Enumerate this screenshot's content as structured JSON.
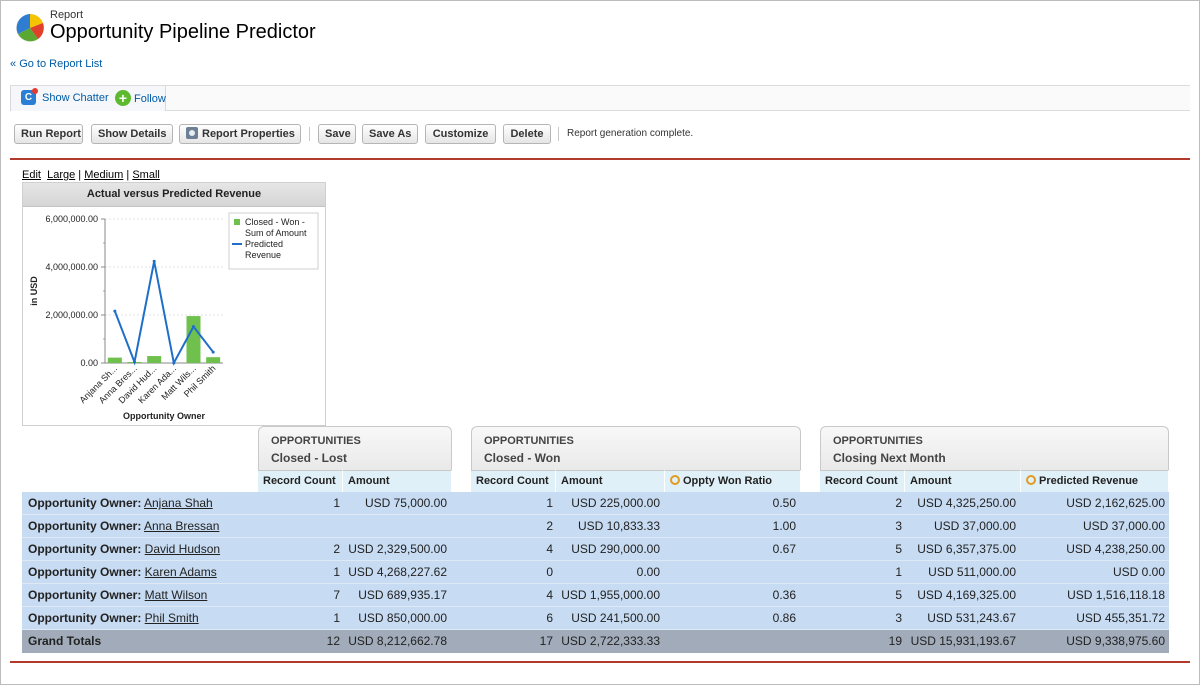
{
  "header": {
    "report_label": "Report",
    "title": "Opportunity Pipeline Predictor",
    "back_link": "Go to Report List",
    "back_marker": "«"
  },
  "chatter": {
    "show_chatter": "Show Chatter",
    "follow": "Follow"
  },
  "toolbar": {
    "buttons": [
      "Run Report",
      "Show Details",
      "Report Properties",
      "Save",
      "Save As",
      "Customize",
      "Delete"
    ],
    "status": "Report generation complete."
  },
  "chart_options": {
    "edit": "Edit",
    "large": "Large",
    "medium": "Medium",
    "small": "Small",
    "sep": "|"
  },
  "chart_data": {
    "type": "bar",
    "title": "Actual versus Predicted Revenue",
    "xlabel": "Opportunity Owner",
    "ylabel": "in USD",
    "ylim": [
      0,
      6000000
    ],
    "yticks": [
      "6,000,000.00",
      "4,000,000.00",
      "2,000,000.00",
      "0.00"
    ],
    "ytick_values": [
      6000000,
      4000000,
      2000000,
      0
    ],
    "categories": [
      "Anjana Sh...",
      "Anna Bres...",
      "David Hud...",
      "Karen Ada...",
      "Matt Wils...",
      "Phil Smith"
    ],
    "series": [
      {
        "name": "Closed - Won - Sum of Amount",
        "kind": "bar",
        "color": "#6fc04c",
        "values": [
          225000,
          10833.33,
          290000,
          0,
          1955000,
          241500
        ]
      },
      {
        "name": "Predicted Revenue",
        "kind": "line",
        "color": "#1f6fc9",
        "values": [
          2162625,
          37000,
          4238250,
          0,
          1516118.18,
          455351.72
        ]
      }
    ],
    "legend": [
      "Closed - Won -",
      "Sum of Amount",
      "Predicted",
      "Revenue"
    ],
    "legend_position": "top-right",
    "grid": true
  },
  "groups": [
    {
      "line1": "OPPORTUNITIES",
      "line2": "Closed - Lost"
    },
    {
      "line1": "OPPORTUNITIES",
      "line2": "Closed - Won"
    },
    {
      "line1": "OPPORTUNITIES",
      "line2": "Closing Next Month"
    }
  ],
  "columns": [
    "Record Count",
    "Amount",
    "Record Count",
    "Amount",
    "Oppty Won Ratio",
    "Record Count",
    "Amount",
    "Predicted Revenue"
  ],
  "owner_prefix": "Opportunity Owner:",
  "rows": [
    {
      "owner": "Anjana Shah",
      "cells": [
        "1",
        "USD 75,000.00",
        "1",
        "USD 225,000.00",
        "0.50",
        "2",
        "USD 4,325,250.00",
        "USD 2,162,625.00"
      ]
    },
    {
      "owner": "Anna Bressan",
      "cells": [
        "",
        "",
        "2",
        "USD 10,833.33",
        "1.00",
        "3",
        "USD 37,000.00",
        "USD 37,000.00"
      ]
    },
    {
      "owner": "David Hudson",
      "cells": [
        "2",
        "USD 2,329,500.00",
        "4",
        "USD 290,000.00",
        "0.67",
        "5",
        "USD 6,357,375.00",
        "USD 4,238,250.00"
      ]
    },
    {
      "owner": "Karen Adams",
      "cells": [
        "1",
        "USD 4,268,227.62",
        "0",
        "0.00",
        "",
        "1",
        "USD 511,000.00",
        "USD 0.00"
      ]
    },
    {
      "owner": "Matt Wilson",
      "cells": [
        "7",
        "USD 689,935.17",
        "4",
        "USD 1,955,000.00",
        "0.36",
        "5",
        "USD 4,169,325.00",
        "USD 1,516,118.18"
      ]
    },
    {
      "owner": "Phil Smith",
      "cells": [
        "1",
        "USD 850,000.00",
        "6",
        "USD 241,500.00",
        "0.86",
        "3",
        "USD 531,243.67",
        "USD 455,351.72"
      ]
    }
  ],
  "totals": {
    "label": "Grand Totals",
    "cells": [
      "12",
      "USD 8,212,662.78",
      "17",
      "USD 2,722,333.33",
      "",
      "19",
      "USD 15,931,193.67",
      "USD 9,338,975.60"
    ]
  }
}
